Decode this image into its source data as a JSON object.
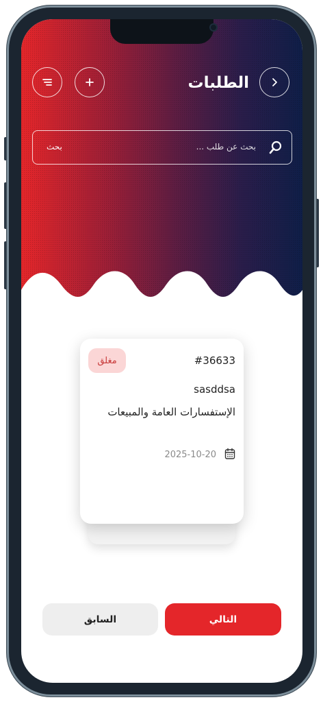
{
  "header": {
    "title": "الطلبات",
    "back_icon": "chevron-right-icon",
    "add_icon": "plus-icon",
    "sort_icon": "sort-icon"
  },
  "search": {
    "placeholder": "بحث عن طلب ...",
    "label": "بحث",
    "icon": "search-icon"
  },
  "request_card": {
    "id": "#36633",
    "status": "مغلق",
    "name": "sasddsa",
    "category": "الإستفسارات العامة والمبيعات",
    "date": "2025-10-20",
    "date_icon": "calendar-icon"
  },
  "pagination": {
    "next_label": "التالي",
    "prev_label": "السابق"
  },
  "colors": {
    "accent": "#e4262a",
    "gradient_start": "#e4262a",
    "gradient_end": "#0f1e48",
    "badge_bg": "#fbd6d6",
    "badge_text": "#c83a3a"
  }
}
